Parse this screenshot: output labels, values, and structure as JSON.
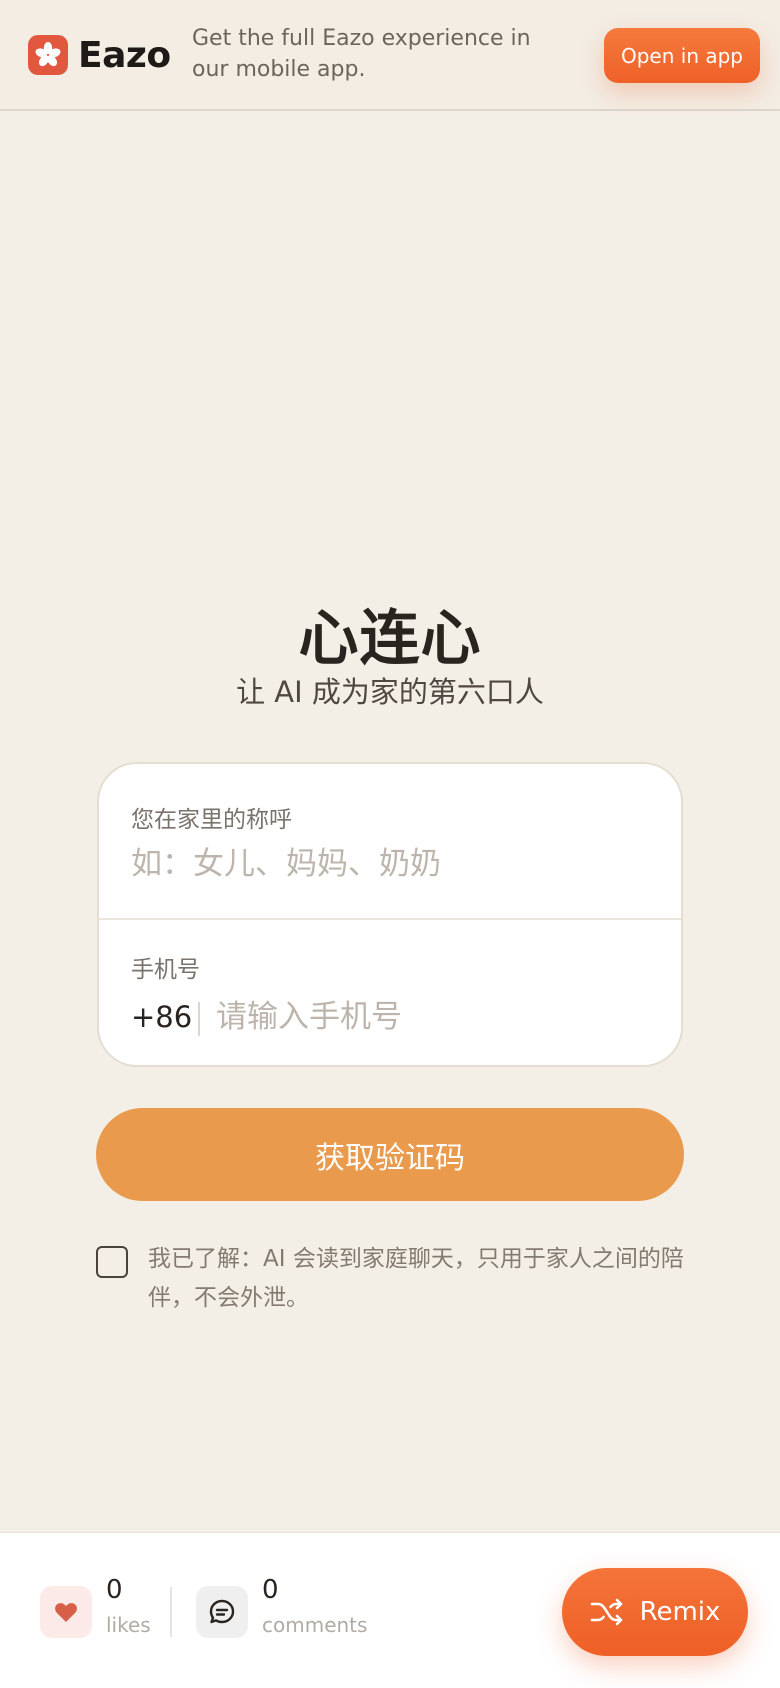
{
  "banner": {
    "brand_name": "Eazo",
    "promo_text": "Get the full Eazo experience in our mobile app.",
    "open_button": "Open in app"
  },
  "hero": {
    "title": "心连心",
    "subtitle": "让 AI 成为家的第六口人"
  },
  "form": {
    "nickname": {
      "label": "您在家里的称呼",
      "placeholder": "如：女儿、妈妈、奶奶",
      "value": ""
    },
    "phone": {
      "label": "手机号",
      "country_code": "+86",
      "placeholder": "请输入手机号",
      "value": ""
    },
    "submit_label": "获取验证码"
  },
  "consent": {
    "checked": false,
    "text": "我已了解：AI 会读到家庭聊天，只用于家人之间的陪伴，不会外泄。"
  },
  "stats": {
    "likes_count": "0",
    "likes_label": "likes",
    "comments_count": "0",
    "comments_label": "comments"
  },
  "remix_label": "Remix",
  "colors": {
    "accent": "#ee6128",
    "primary_button": "#e99a4d",
    "background": "#f4efe6"
  },
  "icons": {
    "brand": "eazo-logo-icon",
    "like": "heart-icon",
    "comment": "comment-icon",
    "remix": "shuffle-icon"
  }
}
